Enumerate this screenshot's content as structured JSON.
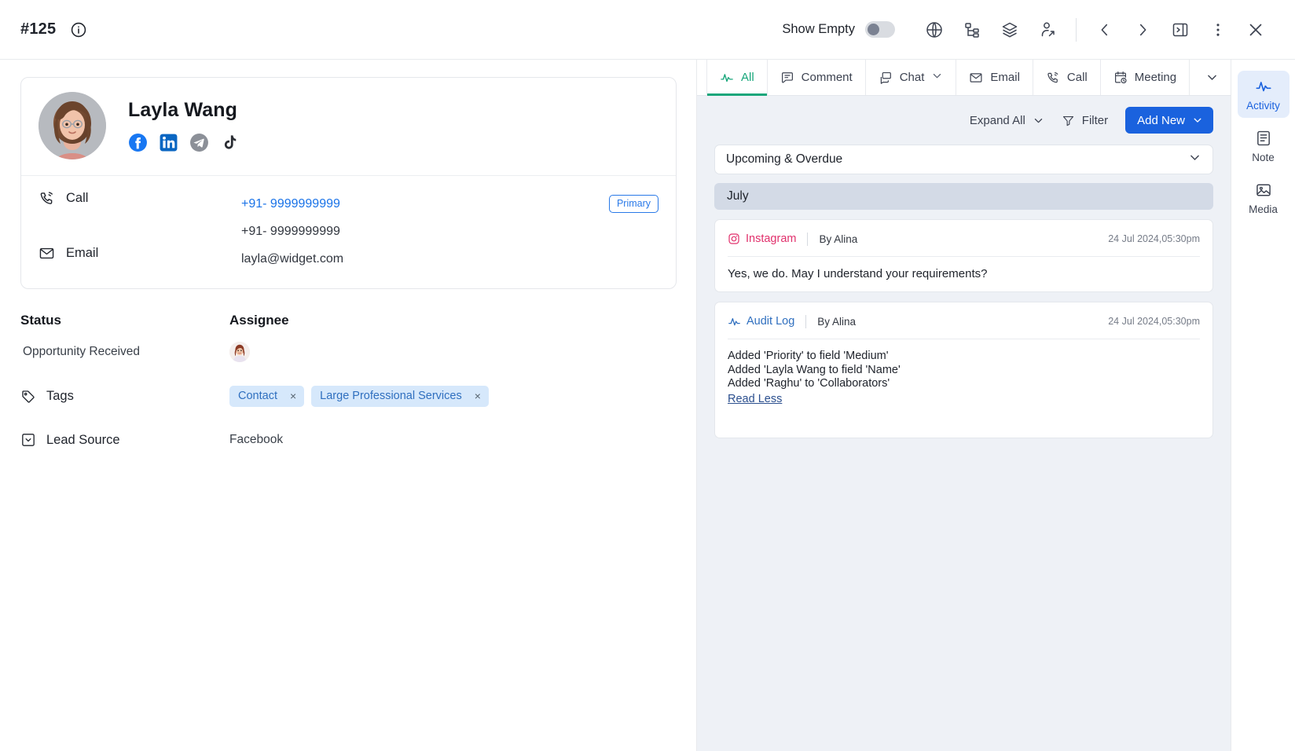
{
  "topbar": {
    "record_id": "#125",
    "info_icon": "info-circle-icon",
    "show_empty_label": "Show Empty",
    "show_empty_on": false,
    "icons": [
      {
        "name": "globe-icon",
        "label": "Globe"
      },
      {
        "name": "hierarchy-icon",
        "label": "Hierarchy"
      },
      {
        "name": "layers-icon",
        "label": "Layers"
      },
      {
        "name": "share-user-icon",
        "label": "Share User"
      }
    ],
    "nav": [
      {
        "name": "prev-record-icon",
        "label": "Previous"
      },
      {
        "name": "next-record-icon",
        "label": "Next"
      },
      {
        "name": "collapse-panel-icon",
        "label": "Collapse Panel"
      },
      {
        "name": "more-options-icon",
        "label": "More"
      },
      {
        "name": "close-icon",
        "label": "Close"
      }
    ]
  },
  "contact": {
    "name": "Layla Wang",
    "avatar_alt": "contact-avatar",
    "socials": [
      {
        "name": "facebook-icon",
        "label": "Facebook"
      },
      {
        "name": "linkedin-icon",
        "label": "LinkedIn"
      },
      {
        "name": "telegram-icon",
        "label": "Telegram"
      },
      {
        "name": "tiktok-icon",
        "label": "TikTok"
      }
    ],
    "call": {
      "label": "Call",
      "primary_number": "+91- 9999999999",
      "secondary_number": "+91- 9999999999",
      "primary_badge": "Primary"
    },
    "email": {
      "label": "Email",
      "value": "layla@widget.com"
    }
  },
  "fields": {
    "status": {
      "label": "Status",
      "value": "Opportunity Received"
    },
    "assignee": {
      "label": "Assignee",
      "avatar_alt": "assignee-avatar"
    },
    "tags": {
      "label": "Tags",
      "items": [
        {
          "label": "Contact",
          "remove": "×"
        },
        {
          "label": "Large Professional Services",
          "remove": "×"
        }
      ]
    },
    "lead_source": {
      "label": "Lead Source",
      "value": "Facebook"
    }
  },
  "activity": {
    "tabs": [
      {
        "label": "All",
        "icon": "activity-pulse-icon",
        "active": true,
        "caret": false
      },
      {
        "label": "Comment",
        "icon": "comment-icon",
        "active": false,
        "caret": false
      },
      {
        "label": "Chat",
        "icon": "chat-icon",
        "active": false,
        "caret": true
      },
      {
        "label": "Email",
        "icon": "email-icon",
        "active": false,
        "caret": false
      },
      {
        "label": "Call",
        "icon": "call-icon",
        "active": false,
        "caret": false
      },
      {
        "label": "Meeting",
        "icon": "meeting-icon",
        "active": false,
        "caret": false
      }
    ],
    "tabs_more_icon": "chevron-down-icon",
    "toolbar": {
      "expand_all": "Expand All",
      "filter": "Filter",
      "add_new": "Add New"
    },
    "filter_select": {
      "value": "Upcoming & Overdue"
    },
    "month_group": "July",
    "items": [
      {
        "channel": "Instagram",
        "channel_icon": "instagram-icon",
        "author": "By Alina",
        "timestamp": "24 Jul 2024,05:30pm",
        "body": "Yes, we do. May I understand your requirements?",
        "lines": [],
        "read_less": ""
      },
      {
        "channel": "Audit Log",
        "channel_icon": "audit-log-icon",
        "author": "By Alina",
        "timestamp": "24 Jul 2024,05:30pm",
        "body": "",
        "lines": [
          "Added 'Priority' to field 'Medium'",
          "Added 'Layla Wang to field 'Name'",
          "Added 'Raghu' to 'Collaborators'"
        ],
        "read_less": "Read Less"
      }
    ]
  },
  "rail": {
    "items": [
      {
        "label": "Activity",
        "icon": "activity-pulse-icon",
        "active": true
      },
      {
        "label": "Note",
        "icon": "note-icon",
        "active": false
      },
      {
        "label": "Media",
        "icon": "media-image-icon",
        "active": false
      }
    ]
  },
  "colors": {
    "accent_blue": "#1a62de",
    "accent_green": "#17a67a",
    "instagram": "#e1306c",
    "link_blue": "#1a73e8"
  }
}
